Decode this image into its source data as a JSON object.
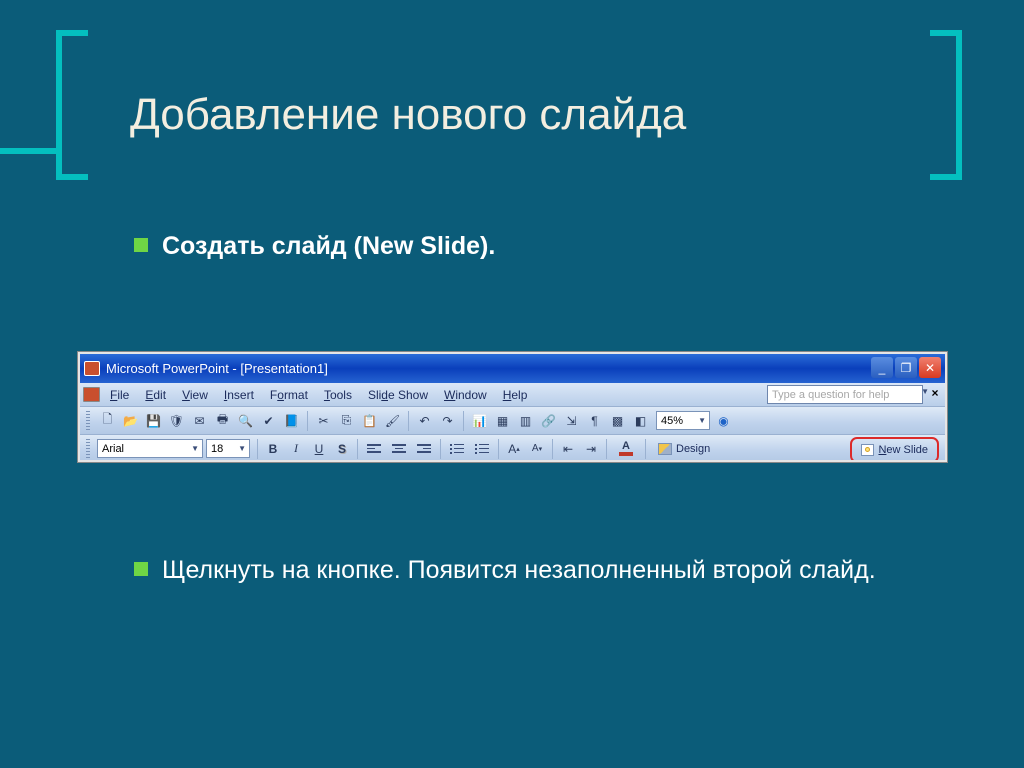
{
  "title": "Добавление нового слайда",
  "bullets": {
    "b1": "Создать слайд (New Slide).",
    "b2": "Щелкнуть на кнопке. Появится незаполненный второй слайд."
  },
  "pp": {
    "title": "Microsoft PowerPoint - [Presentation1]",
    "menu": {
      "file": "File",
      "edit": "Edit",
      "view": "View",
      "insert": "Insert",
      "format": "Format",
      "tools": "Tools",
      "slideshow": "Slide Show",
      "window": "Window",
      "help": "Help"
    },
    "ask_placeholder": "Type a question for help",
    "zoom": "45%",
    "font_name": "Arial",
    "font_size": "18",
    "design_label": "Design",
    "newslide_label": "New Slide",
    "winbtn": {
      "min": "_",
      "max": "❐",
      "close": "✕"
    },
    "fmt_B": "B",
    "fmt_I": "I",
    "fmt_U": "U",
    "fmt_S": "S",
    "fmt_Aup": "A",
    "fmt_Adown": "A",
    "fmt_fontA": "A"
  }
}
